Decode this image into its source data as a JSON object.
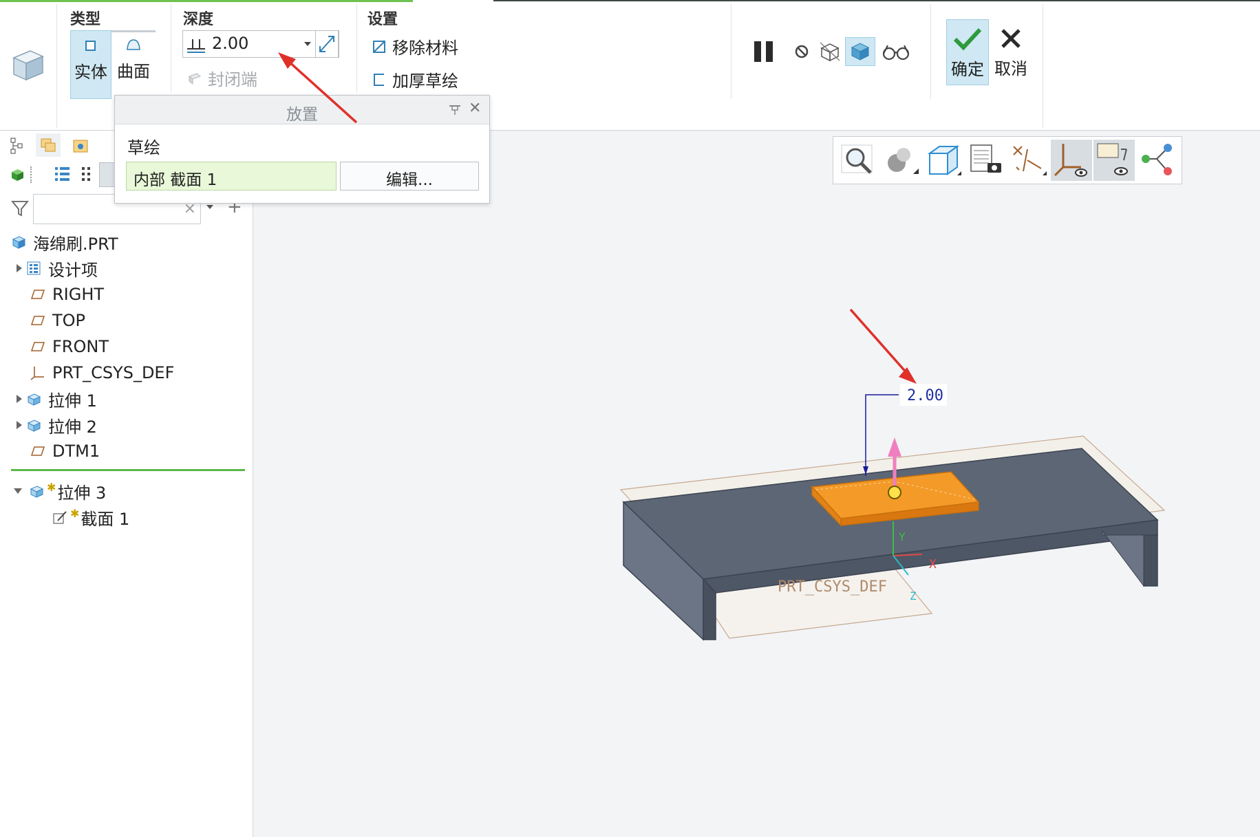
{
  "ribbon": {
    "type_group": {
      "title": "类型",
      "solid_label": "实体",
      "surface_label": "曲面"
    },
    "depth_group": {
      "title": "深度",
      "value": "2.00",
      "capped_ends_label": "封闭端"
    },
    "settings_group": {
      "title": "设置",
      "remove_material_label": "移除材料",
      "thicken_sketch_label": "加厚草绘"
    },
    "confirm_label": "确定",
    "cancel_label": "取消"
  },
  "placement_popup": {
    "title": "放置",
    "sketch_label": "草绘",
    "section_value": "内部 截面 1",
    "edit_button_label": "编辑..."
  },
  "model_tree": {
    "root": "海绵刷.PRT",
    "items": [
      {
        "label": "设计项",
        "icon": "design-items-icon",
        "expandable": true
      },
      {
        "label": "RIGHT",
        "icon": "datum-plane-icon",
        "expandable": false
      },
      {
        "label": "TOP",
        "icon": "datum-plane-icon",
        "expandable": false
      },
      {
        "label": "FRONT",
        "icon": "datum-plane-icon",
        "expandable": false
      },
      {
        "label": "PRT_CSYS_DEF",
        "icon": "csys-icon",
        "expandable": false
      },
      {
        "label": "拉伸 1",
        "icon": "extrude-icon",
        "expandable": true
      },
      {
        "label": "拉伸 2",
        "icon": "extrude-icon",
        "expandable": true
      },
      {
        "label": "DTM1",
        "icon": "datum-plane-icon",
        "expandable": false
      }
    ],
    "active_feature": {
      "label": "拉伸 3",
      "child_label": "截面 1"
    }
  },
  "viewport": {
    "dimension_label": "2.00",
    "csys_label": "PRT_CSYS_DEF",
    "axis_x": "X",
    "axis_y": "Y",
    "axis_z": "Z"
  },
  "colors": {
    "accent_blue": "#cfe8f3",
    "active_green": "#6ec04f",
    "extrude_orange": "#f39a28",
    "model_gray": "#5c6675",
    "annotation_red": "#e0302a"
  }
}
